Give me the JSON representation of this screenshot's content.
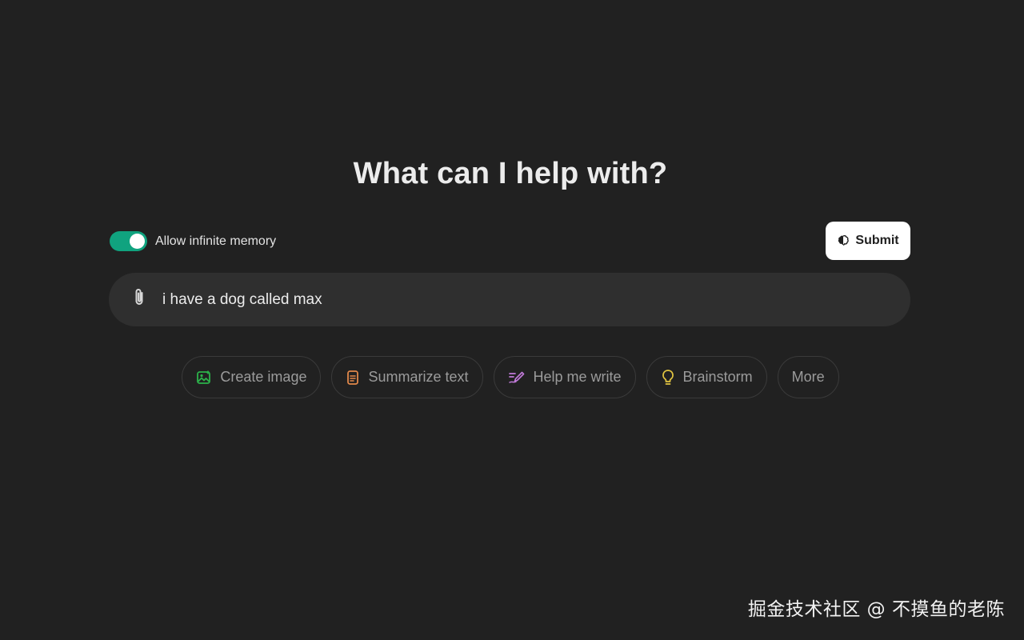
{
  "heading": "What can I help with?",
  "memory": {
    "label": "Allow infinite memory",
    "enabled": true,
    "accent": "#10a37f"
  },
  "submit": {
    "label": "Submit",
    "icon": "brain-icon"
  },
  "composer": {
    "value": "i have a dog called max",
    "attach_icon": "paperclip-icon"
  },
  "suggestions": [
    {
      "label": "Create image",
      "icon": "image-icon",
      "color": "#2cb34a"
    },
    {
      "label": "Summarize text",
      "icon": "document-icon",
      "color": "#e2884a"
    },
    {
      "label": "Help me write",
      "icon": "pen-icon",
      "color": "#c07ad8"
    },
    {
      "label": "Brainstorm",
      "icon": "lightbulb-icon",
      "color": "#e2c541"
    },
    {
      "label": "More",
      "icon": "",
      "color": ""
    }
  ],
  "watermark": "掘金技术社区 @ 不摸鱼的老陈"
}
